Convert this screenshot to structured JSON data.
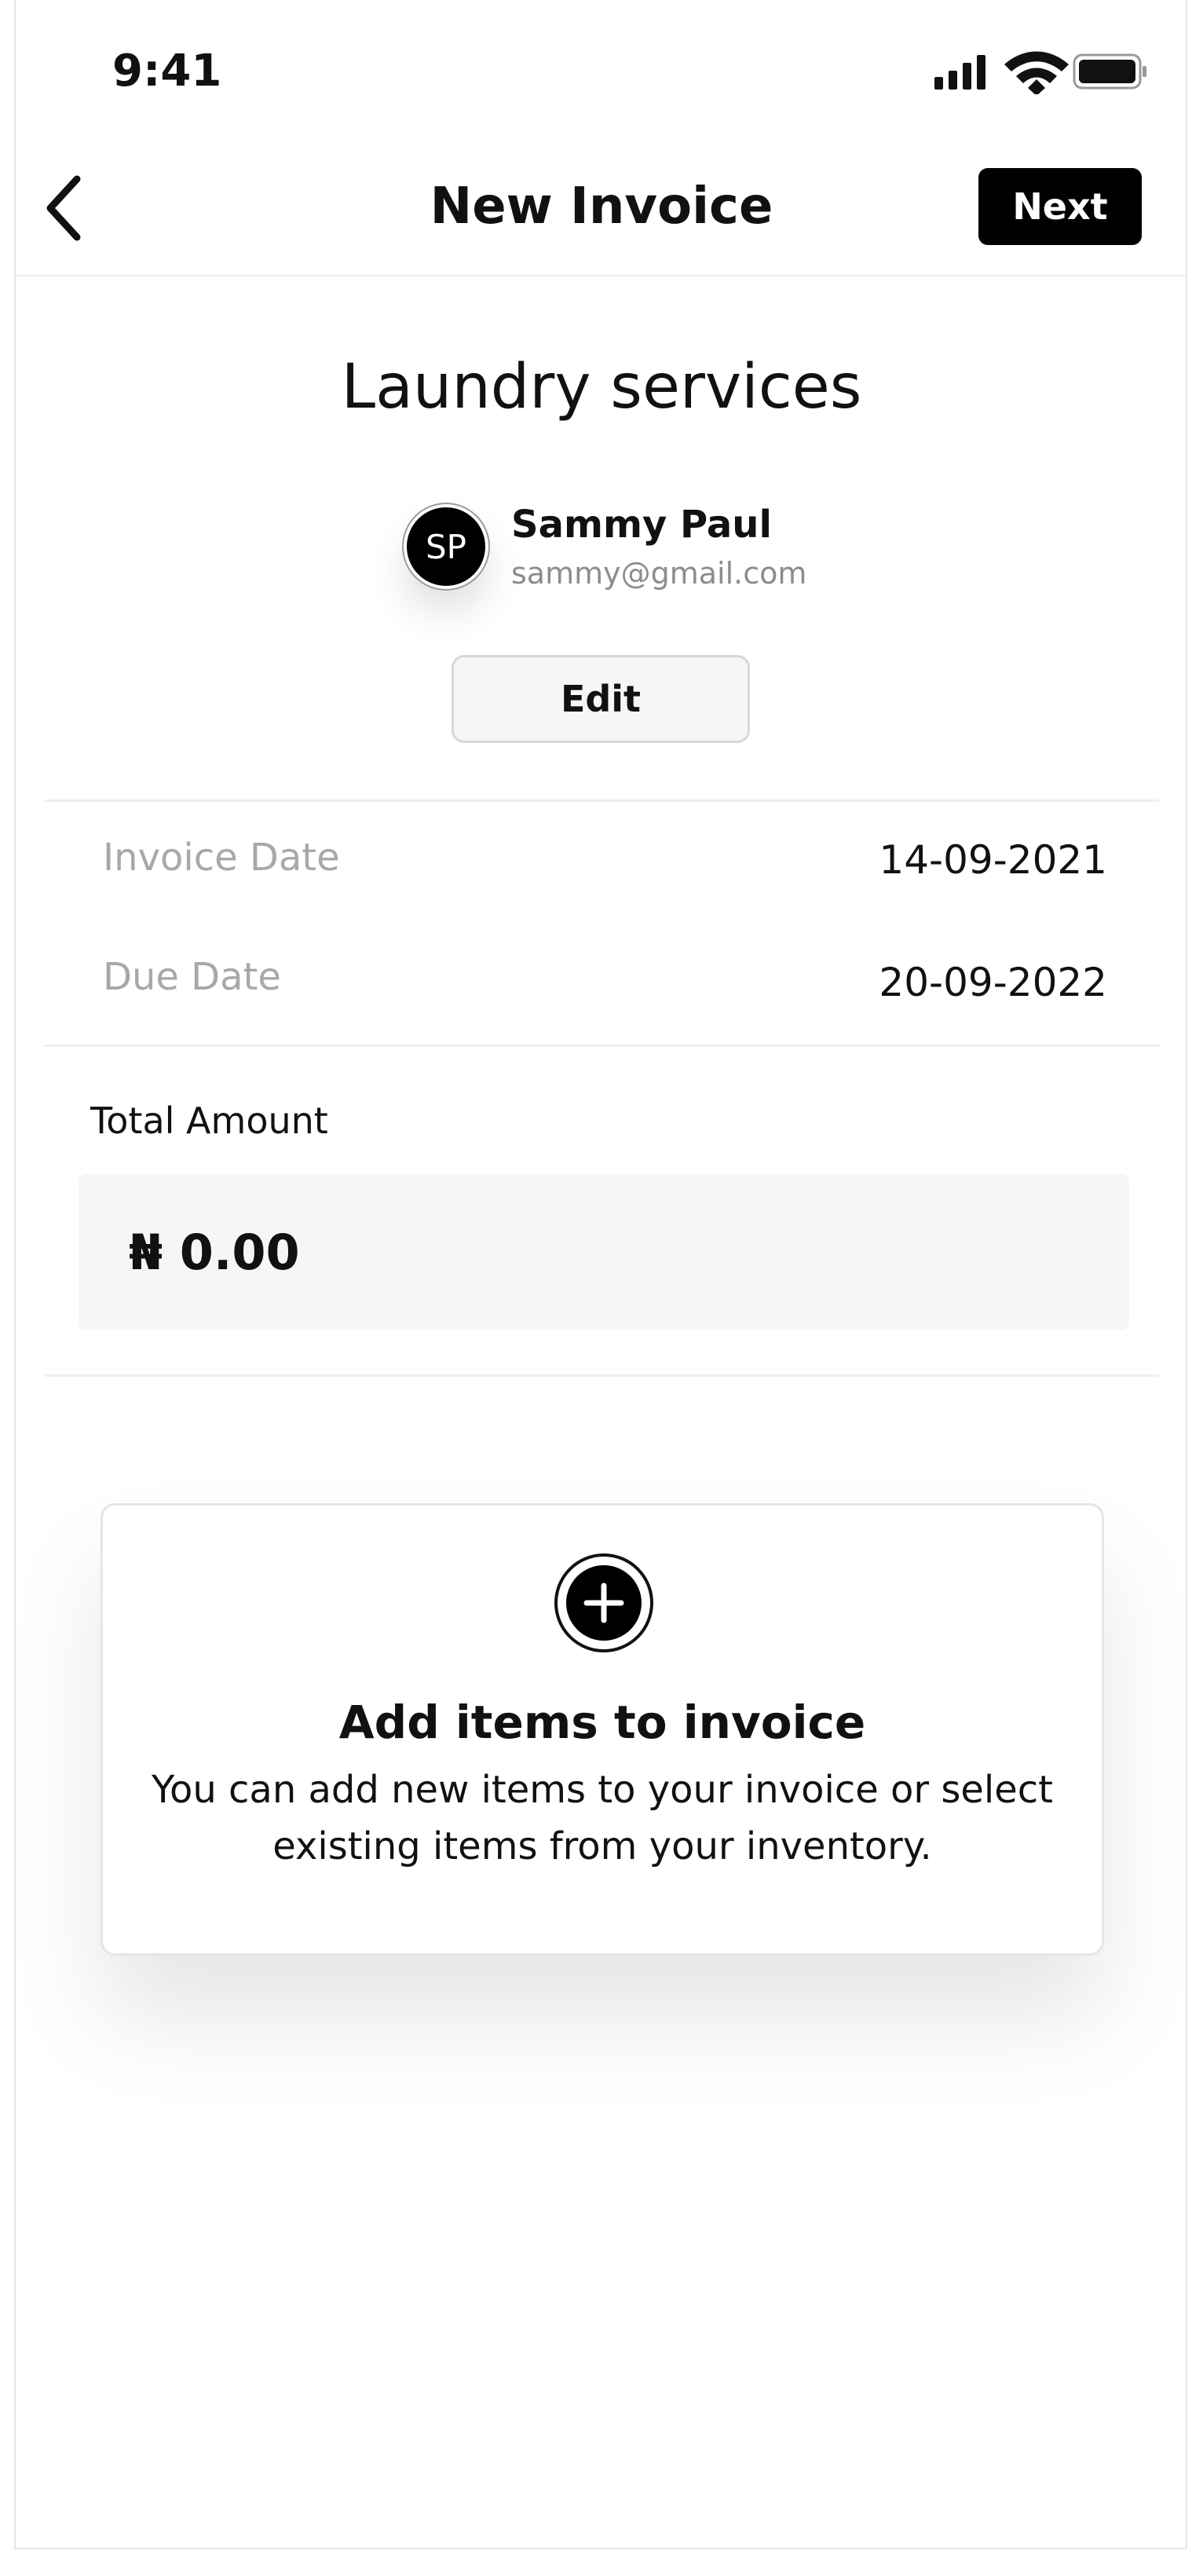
{
  "status_bar": {
    "time": "9:41"
  },
  "nav": {
    "title": "New Invoice",
    "next_label": "Next",
    "back_icon": "chevron-left-icon"
  },
  "invoice": {
    "service_title": "Laundry services",
    "client": {
      "initials": "SP",
      "name": "Sammy Paul",
      "email": "sammy@gmail.com"
    },
    "edit_label": "Edit",
    "invoice_date_label": "Invoice Date",
    "invoice_date_value": "14-09-2021",
    "due_date_label": "Due Date",
    "due_date_value": "20-09-2022",
    "total_label": "Total Amount",
    "total_value": "₦ 0.00"
  },
  "add_items": {
    "title": "Add items to invoice",
    "description": "You can add new items to your invoice or select existing items from your inventory.",
    "icon": "plus-circle-icon"
  },
  "colors": {
    "primary": "#000000",
    "muted_text": "#a8a8a8",
    "email_text": "#8c8c8c",
    "surface": "#f6f6f6",
    "divider": "#efefef"
  }
}
